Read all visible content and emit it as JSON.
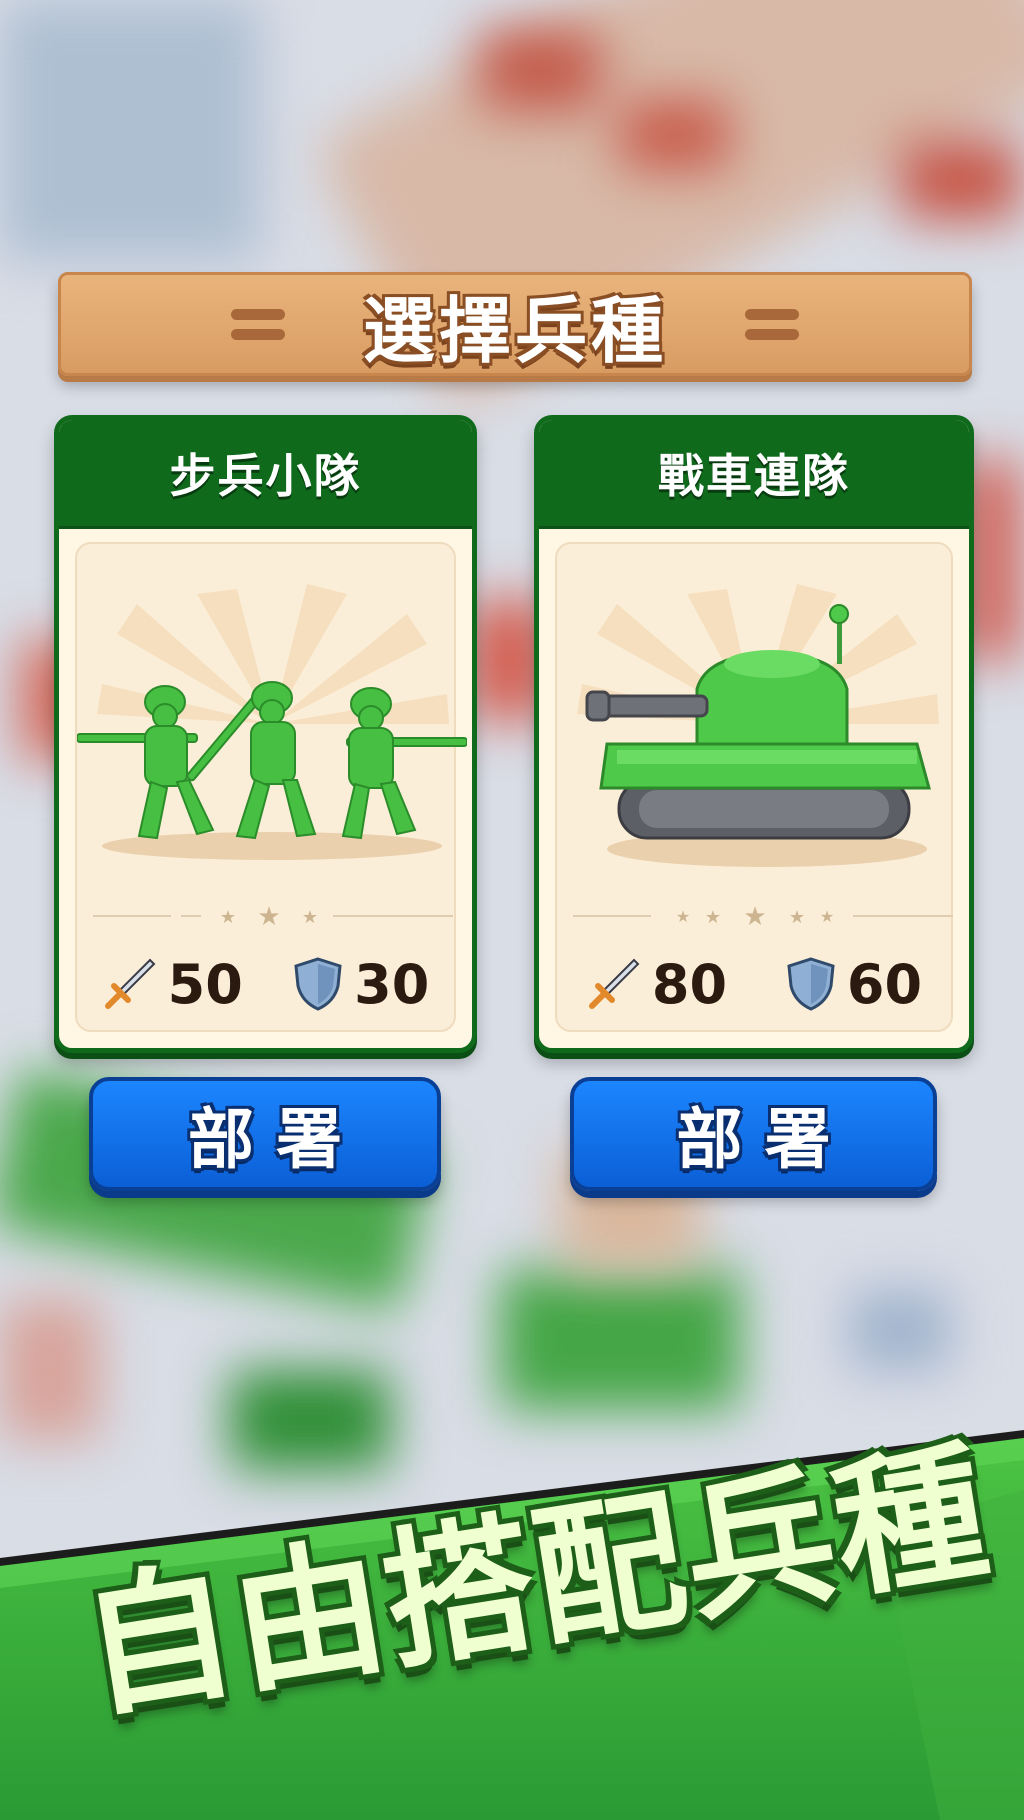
{
  "title": "選擇兵種",
  "units": [
    {
      "name": "步兵小隊",
      "attack": "50",
      "defense": "30",
      "stars": 3,
      "icon": "infantry-soldiers-icon",
      "deploy_label": "部署"
    },
    {
      "name": "戰車連隊",
      "attack": "80",
      "defense": "60",
      "stars": 5,
      "icon": "tank-icon",
      "deploy_label": "部署"
    }
  ],
  "slogan": "自由搭配兵種",
  "colors": {
    "card_green": "#0f6a1c",
    "button_blue": "#1c86ff",
    "banner_tan": "#e3a86e",
    "toy_green": "#4fc94a"
  }
}
